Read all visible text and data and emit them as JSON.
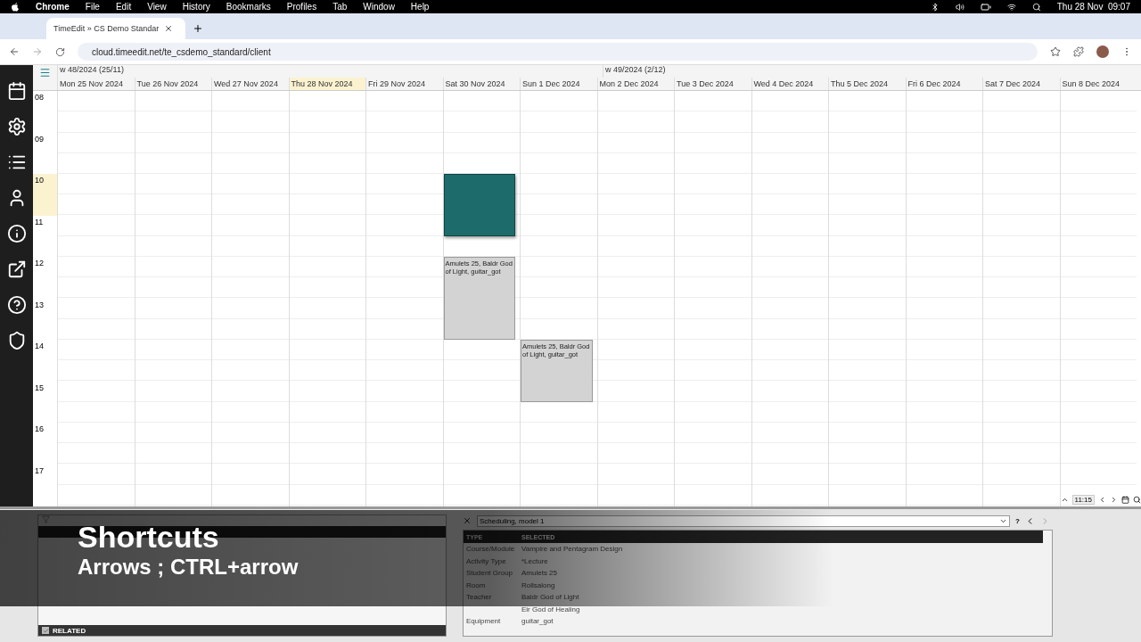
{
  "menu_bar": {
    "app": "Chrome",
    "items": [
      "File",
      "Edit",
      "View",
      "History",
      "Bookmarks",
      "Profiles",
      "Tab",
      "Window",
      "Help"
    ],
    "clock": "Thu 28 Nov  09:07"
  },
  "browser": {
    "tab_title": "TimeEdit » CS Demo Standar",
    "url": "cloud.timeedit.net/te_csdemo_standard/client"
  },
  "calendar": {
    "weeks": [
      {
        "label": "w 48/2024 (25/11)"
      },
      {
        "label": "w 49/2024 (2/12)"
      }
    ],
    "hours": [
      {
        "label": "08",
        "current": false
      },
      {
        "label": "09",
        "current": false
      },
      {
        "label": "10",
        "current": true
      },
      {
        "label": "11",
        "current": false
      },
      {
        "label": "12",
        "current": false
      },
      {
        "label": "13",
        "current": false
      },
      {
        "label": "14",
        "current": false
      },
      {
        "label": "15",
        "current": false
      },
      {
        "label": "16",
        "current": false
      },
      {
        "label": "17",
        "current": false
      }
    ],
    "days": [
      {
        "label": "Mon 25 Nov 2024",
        "today": false
      },
      {
        "label": "Tue 26 Nov 2024",
        "today": false
      },
      {
        "label": "Wed 27 Nov 2024",
        "today": false
      },
      {
        "label": "Thu 28 Nov 2024",
        "today": true
      },
      {
        "label": "Fri 29 Nov 2024",
        "today": false
      },
      {
        "label": "Sat 30 Nov 2024",
        "today": false,
        "events": [
          {
            "selected": true
          },
          {
            "selected": false,
            "text": "Amulets 25, Baldr God of Light, guitar_got"
          }
        ]
      },
      {
        "label": "Sun 1 Dec 2024",
        "today": false,
        "events": [
          {
            "selected": false,
            "text": "Amulets 25, Baldr God of Light, guitar_got"
          }
        ]
      },
      {
        "label": "Mon 2 Dec 2024",
        "today": false
      },
      {
        "label": "Tue 3 Dec 2024",
        "today": false
      },
      {
        "label": "Wed 4 Dec 2024",
        "today": false
      },
      {
        "label": "Thu 5 Dec 2024",
        "today": false
      },
      {
        "label": "Fri 6 Dec 2024",
        "today": false
      },
      {
        "label": "Sat 7 Dec 2024",
        "today": false
      },
      {
        "label": "Sun 8 Dec 2024",
        "today": false
      }
    ],
    "time_display": "11:15"
  },
  "related_panel": {
    "related": {
      "label": "RELATED",
      "checked": true
    }
  },
  "selection_panel": {
    "model": "Scheduling, model 1",
    "help": "?",
    "columns": [
      "TYPE",
      "SELECTED"
    ],
    "rows": [
      {
        "type": "Course/Module",
        "selected": "Vampire and Pentagram Design"
      },
      {
        "type": "Activity Type",
        "selected": "*Lecture"
      },
      {
        "type": "Student Group",
        "selected": "Amulets 25"
      },
      {
        "type": "Room",
        "selected": "Rollsalong"
      },
      {
        "type": "Teacher",
        "selected": "Baldr God of Light"
      },
      {
        "selected": "Eir God of Healing"
      },
      {
        "type": "Equipment",
        "selected": "guitar_got"
      }
    ]
  },
  "caption": {
    "title": "Shortcuts",
    "subtitle": "Arrows ; CTRL+arrow"
  }
}
